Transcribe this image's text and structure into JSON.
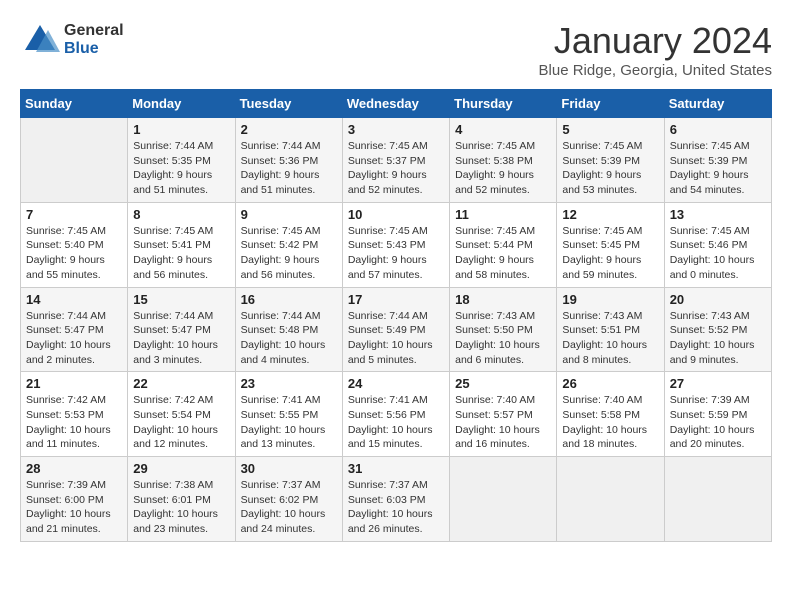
{
  "logo": {
    "general": "General",
    "blue": "Blue"
  },
  "title": "January 2024",
  "subtitle": "Blue Ridge, Georgia, United States",
  "headers": [
    "Sunday",
    "Monday",
    "Tuesday",
    "Wednesday",
    "Thursday",
    "Friday",
    "Saturday"
  ],
  "weeks": [
    [
      {
        "day": "",
        "sunrise": "",
        "sunset": "",
        "daylight": ""
      },
      {
        "day": "1",
        "sunrise": "Sunrise: 7:44 AM",
        "sunset": "Sunset: 5:35 PM",
        "daylight": "Daylight: 9 hours and 51 minutes."
      },
      {
        "day": "2",
        "sunrise": "Sunrise: 7:44 AM",
        "sunset": "Sunset: 5:36 PM",
        "daylight": "Daylight: 9 hours and 51 minutes."
      },
      {
        "day": "3",
        "sunrise": "Sunrise: 7:45 AM",
        "sunset": "Sunset: 5:37 PM",
        "daylight": "Daylight: 9 hours and 52 minutes."
      },
      {
        "day": "4",
        "sunrise": "Sunrise: 7:45 AM",
        "sunset": "Sunset: 5:38 PM",
        "daylight": "Daylight: 9 hours and 52 minutes."
      },
      {
        "day": "5",
        "sunrise": "Sunrise: 7:45 AM",
        "sunset": "Sunset: 5:39 PM",
        "daylight": "Daylight: 9 hours and 53 minutes."
      },
      {
        "day": "6",
        "sunrise": "Sunrise: 7:45 AM",
        "sunset": "Sunset: 5:39 PM",
        "daylight": "Daylight: 9 hours and 54 minutes."
      }
    ],
    [
      {
        "day": "7",
        "sunrise": "Sunrise: 7:45 AM",
        "sunset": "Sunset: 5:40 PM",
        "daylight": "Daylight: 9 hours and 55 minutes."
      },
      {
        "day": "8",
        "sunrise": "Sunrise: 7:45 AM",
        "sunset": "Sunset: 5:41 PM",
        "daylight": "Daylight: 9 hours and 56 minutes."
      },
      {
        "day": "9",
        "sunrise": "Sunrise: 7:45 AM",
        "sunset": "Sunset: 5:42 PM",
        "daylight": "Daylight: 9 hours and 56 minutes."
      },
      {
        "day": "10",
        "sunrise": "Sunrise: 7:45 AM",
        "sunset": "Sunset: 5:43 PM",
        "daylight": "Daylight: 9 hours and 57 minutes."
      },
      {
        "day": "11",
        "sunrise": "Sunrise: 7:45 AM",
        "sunset": "Sunset: 5:44 PM",
        "daylight": "Daylight: 9 hours and 58 minutes."
      },
      {
        "day": "12",
        "sunrise": "Sunrise: 7:45 AM",
        "sunset": "Sunset: 5:45 PM",
        "daylight": "Daylight: 9 hours and 59 minutes."
      },
      {
        "day": "13",
        "sunrise": "Sunrise: 7:45 AM",
        "sunset": "Sunset: 5:46 PM",
        "daylight": "Daylight: 10 hours and 0 minutes."
      }
    ],
    [
      {
        "day": "14",
        "sunrise": "Sunrise: 7:44 AM",
        "sunset": "Sunset: 5:47 PM",
        "daylight": "Daylight: 10 hours and 2 minutes."
      },
      {
        "day": "15",
        "sunrise": "Sunrise: 7:44 AM",
        "sunset": "Sunset: 5:47 PM",
        "daylight": "Daylight: 10 hours and 3 minutes."
      },
      {
        "day": "16",
        "sunrise": "Sunrise: 7:44 AM",
        "sunset": "Sunset: 5:48 PM",
        "daylight": "Daylight: 10 hours and 4 minutes."
      },
      {
        "day": "17",
        "sunrise": "Sunrise: 7:44 AM",
        "sunset": "Sunset: 5:49 PM",
        "daylight": "Daylight: 10 hours and 5 minutes."
      },
      {
        "day": "18",
        "sunrise": "Sunrise: 7:43 AM",
        "sunset": "Sunset: 5:50 PM",
        "daylight": "Daylight: 10 hours and 6 minutes."
      },
      {
        "day": "19",
        "sunrise": "Sunrise: 7:43 AM",
        "sunset": "Sunset: 5:51 PM",
        "daylight": "Daylight: 10 hours and 8 minutes."
      },
      {
        "day": "20",
        "sunrise": "Sunrise: 7:43 AM",
        "sunset": "Sunset: 5:52 PM",
        "daylight": "Daylight: 10 hours and 9 minutes."
      }
    ],
    [
      {
        "day": "21",
        "sunrise": "Sunrise: 7:42 AM",
        "sunset": "Sunset: 5:53 PM",
        "daylight": "Daylight: 10 hours and 11 minutes."
      },
      {
        "day": "22",
        "sunrise": "Sunrise: 7:42 AM",
        "sunset": "Sunset: 5:54 PM",
        "daylight": "Daylight: 10 hours and 12 minutes."
      },
      {
        "day": "23",
        "sunrise": "Sunrise: 7:41 AM",
        "sunset": "Sunset: 5:55 PM",
        "daylight": "Daylight: 10 hours and 13 minutes."
      },
      {
        "day": "24",
        "sunrise": "Sunrise: 7:41 AM",
        "sunset": "Sunset: 5:56 PM",
        "daylight": "Daylight: 10 hours and 15 minutes."
      },
      {
        "day": "25",
        "sunrise": "Sunrise: 7:40 AM",
        "sunset": "Sunset: 5:57 PM",
        "daylight": "Daylight: 10 hours and 16 minutes."
      },
      {
        "day": "26",
        "sunrise": "Sunrise: 7:40 AM",
        "sunset": "Sunset: 5:58 PM",
        "daylight": "Daylight: 10 hours and 18 minutes."
      },
      {
        "day": "27",
        "sunrise": "Sunrise: 7:39 AM",
        "sunset": "Sunset: 5:59 PM",
        "daylight": "Daylight: 10 hours and 20 minutes."
      }
    ],
    [
      {
        "day": "28",
        "sunrise": "Sunrise: 7:39 AM",
        "sunset": "Sunset: 6:00 PM",
        "daylight": "Daylight: 10 hours and 21 minutes."
      },
      {
        "day": "29",
        "sunrise": "Sunrise: 7:38 AM",
        "sunset": "Sunset: 6:01 PM",
        "daylight": "Daylight: 10 hours and 23 minutes."
      },
      {
        "day": "30",
        "sunrise": "Sunrise: 7:37 AM",
        "sunset": "Sunset: 6:02 PM",
        "daylight": "Daylight: 10 hours and 24 minutes."
      },
      {
        "day": "31",
        "sunrise": "Sunrise: 7:37 AM",
        "sunset": "Sunset: 6:03 PM",
        "daylight": "Daylight: 10 hours and 26 minutes."
      },
      {
        "day": "",
        "sunrise": "",
        "sunset": "",
        "daylight": ""
      },
      {
        "day": "",
        "sunrise": "",
        "sunset": "",
        "daylight": ""
      },
      {
        "day": "",
        "sunrise": "",
        "sunset": "",
        "daylight": ""
      }
    ]
  ]
}
